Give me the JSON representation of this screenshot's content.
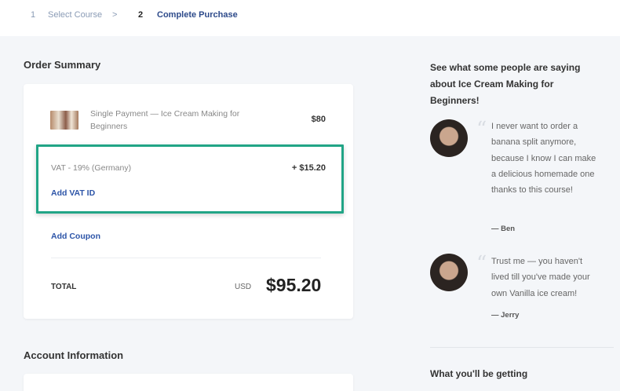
{
  "breadcrumb": {
    "step1_num": "1",
    "step1_label": "Select Course",
    "separator": ">",
    "step2_num": "2",
    "step2_label": "Complete Purchase"
  },
  "order_summary": {
    "title": "Order Summary",
    "item_name": "Single Payment — Ice Cream Making for Beginners",
    "item_price": "$80",
    "vat_label": "VAT - 19% (Germany)",
    "vat_amount": "+ $15.20",
    "add_vat_id": "Add VAT ID",
    "add_coupon": "Add Coupon",
    "total_label": "TOTAL",
    "currency": "USD",
    "total_amount": "$95.20"
  },
  "account_information": {
    "title": "Account Information"
  },
  "testimonials": {
    "title": "See what some people are saying about Ice Cream Making for Beginners!",
    "items": [
      {
        "quote": "I never want to order a banana split anymore, because I know I can make a delicious homemade one thanks to this course!",
        "author": "— Ben"
      },
      {
        "quote": "Trust me — you haven't lived till you've made your own Vanilla ice cream!",
        "author": "— Jerry"
      }
    ]
  },
  "getting": {
    "title": "What you'll be getting"
  },
  "colors": {
    "highlight": "#21a586",
    "link": "#2d55a8",
    "background": "#f4f6f9"
  }
}
